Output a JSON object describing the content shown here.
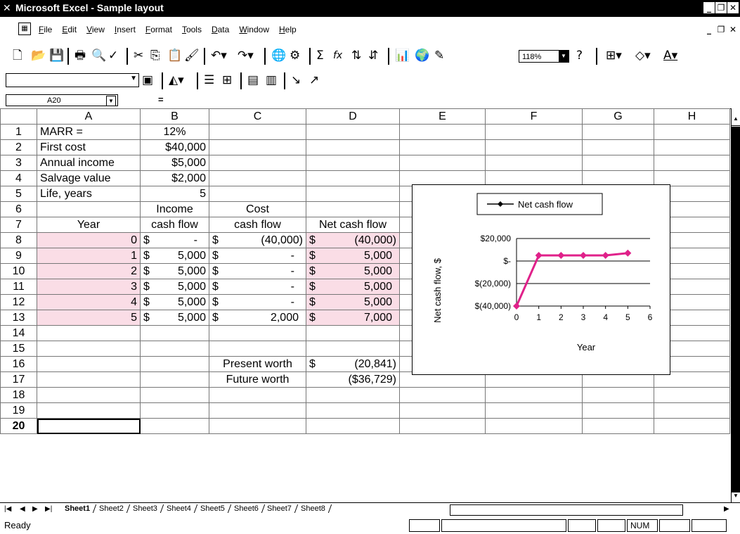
{
  "window": {
    "title": "Microsoft Excel - Sample layout"
  },
  "menu": [
    "File",
    "Edit",
    "View",
    "Insert",
    "Format",
    "Tools",
    "Data",
    "Window",
    "Help"
  ],
  "toolbar": {
    "zoom": "118%",
    "sum_symbol": "Σ",
    "fx_symbol": "fx"
  },
  "formula_bar": {
    "name_box": "A20",
    "equals": "=",
    "content": ""
  },
  "columns": [
    "A",
    "B",
    "C",
    "D",
    "E",
    "F",
    "G",
    "H"
  ],
  "rows": [
    {
      "n": "1",
      "a": "MARR =",
      "b": "12%",
      "c": "",
      "d": ""
    },
    {
      "n": "2",
      "a": "First cost",
      "b": "$40,000",
      "c": "",
      "d": ""
    },
    {
      "n": "3",
      "a": "Annual income",
      "b": "$5,000",
      "c": "",
      "d": ""
    },
    {
      "n": "4",
      "a": "Salvage value",
      "b": "$2,000",
      "c": "",
      "d": ""
    },
    {
      "n": "5",
      "a": "Life, years",
      "b": "5",
      "c": "",
      "d": ""
    },
    {
      "n": "6",
      "a": "",
      "b": "Income",
      "c": "Cost",
      "d": ""
    },
    {
      "n": "7",
      "a": "Year",
      "b": "cash flow",
      "c": "cash flow",
      "d": "Net cash flow"
    },
    {
      "n": "8",
      "a": "0",
      "b_sym": "$",
      "b": "-",
      "c_sym": "$",
      "c": "(40,000)",
      "d_sym": "$",
      "d": "(40,000)"
    },
    {
      "n": "9",
      "a": "1",
      "b_sym": "$",
      "b": "5,000",
      "c_sym": "$",
      "c": "-",
      "d_sym": "$",
      "d": "5,000"
    },
    {
      "n": "10",
      "a": "2",
      "b_sym": "$",
      "b": "5,000",
      "c_sym": "$",
      "c": "-",
      "d_sym": "$",
      "d": "5,000"
    },
    {
      "n": "11",
      "a": "3",
      "b_sym": "$",
      "b": "5,000",
      "c_sym": "$",
      "c": "-",
      "d_sym": "$",
      "d": "5,000"
    },
    {
      "n": "12",
      "a": "4",
      "b_sym": "$",
      "b": "5,000",
      "c_sym": "$",
      "c": "-",
      "d_sym": "$",
      "d": "5,000"
    },
    {
      "n": "13",
      "a": "5",
      "b_sym": "$",
      "b": "5,000",
      "c_sym": "$",
      "c": "2,000",
      "d_sym": "$",
      "d": "7,000"
    },
    {
      "n": "14"
    },
    {
      "n": "15"
    },
    {
      "n": "16",
      "c": "Present worth",
      "d_sym": "$",
      "d": "(20,841)"
    },
    {
      "n": "17",
      "c": "Future worth",
      "d": "($36,729)"
    },
    {
      "n": "18"
    },
    {
      "n": "19"
    },
    {
      "n": "20"
    }
  ],
  "chart_data": {
    "type": "line",
    "legend": "Net cash flow",
    "legend_position": "top",
    "ylabel": "Net cash flow, $",
    "xlabel": "Year",
    "x": [
      0,
      1,
      2,
      3,
      4,
      5
    ],
    "series": [
      {
        "name": "Net cash flow",
        "values": [
          -40000,
          5000,
          5000,
          5000,
          5000,
          7000
        ]
      }
    ],
    "xticks": [
      "0",
      "1",
      "2",
      "3",
      "4",
      "5",
      "6"
    ],
    "yticks": [
      "$20,000",
      "$-",
      "$(20,000)",
      "$(40,000)"
    ],
    "ytick_values": [
      20000,
      0,
      -20000,
      -40000
    ],
    "xlim": [
      0,
      6
    ],
    "ylim": [
      -40000,
      20000
    ],
    "color": "#e0218a",
    "grid": "horizontal"
  },
  "sheets": [
    "Sheet1",
    "Sheet2",
    "Sheet3",
    "Sheet4",
    "Sheet5",
    "Sheet6",
    "Sheet7",
    "Sheet8"
  ],
  "status": {
    "ready": "Ready",
    "num": "NUM"
  }
}
